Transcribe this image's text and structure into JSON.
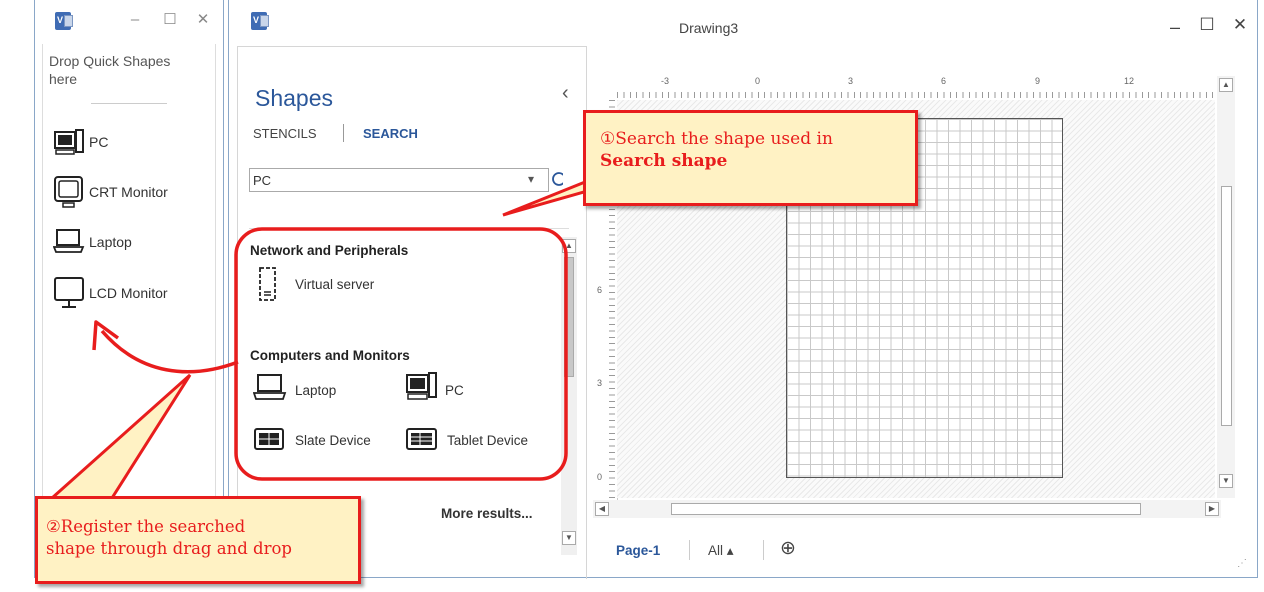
{
  "quick_window": {
    "drop_text": "Drop Quick Shapes here",
    "items": [
      {
        "label": "PC",
        "icon": "pc-icon"
      },
      {
        "label": "CRT Monitor",
        "icon": "crt-monitor-icon"
      },
      {
        "label": "Laptop",
        "icon": "laptop-icon"
      },
      {
        "label": "LCD Monitor",
        "icon": "lcd-monitor-icon"
      }
    ]
  },
  "main_window": {
    "title": "Drawing3",
    "controls": {
      "minimize": "–",
      "maximize": "☐",
      "close": "✕"
    }
  },
  "shapes_panel": {
    "title": "Shapes",
    "collapse": "‹",
    "tabs": {
      "stencils": "STENCILS",
      "search": "SEARCH"
    },
    "search": {
      "value": "PC",
      "dropdown": "▾"
    },
    "groups": [
      {
        "title": "Network and Peripherals",
        "items": [
          {
            "label": "Virtual server",
            "icon": "virtual-server-icon"
          }
        ]
      },
      {
        "title": "Computers and Monitors",
        "items": [
          {
            "label": "Laptop",
            "icon": "laptop-icon"
          },
          {
            "label": "PC",
            "icon": "pc-icon"
          },
          {
            "label": "Slate Device",
            "icon": "slate-device-icon"
          },
          {
            "label": "Tablet Device",
            "icon": "tablet-device-icon"
          }
        ]
      }
    ],
    "more_results": "More results..."
  },
  "ruler": {
    "top_ticks": [
      "-3",
      "0",
      "3",
      "6",
      "9",
      "12"
    ],
    "left_ticks": [
      "6",
      "3",
      "0"
    ]
  },
  "page_tabs": {
    "page": "Page-1",
    "all": "All ▴",
    "add": "⊕"
  },
  "callouts": {
    "one": {
      "line1": "①Search the shape used in",
      "line2": "Search shape"
    },
    "two": {
      "line1": "②Register the searched",
      "line2": "shape through drag and drop"
    }
  },
  "colors": {
    "accent": "#2b579a",
    "callout_border": "#e81d1d",
    "callout_fill": "#fff2c4"
  }
}
